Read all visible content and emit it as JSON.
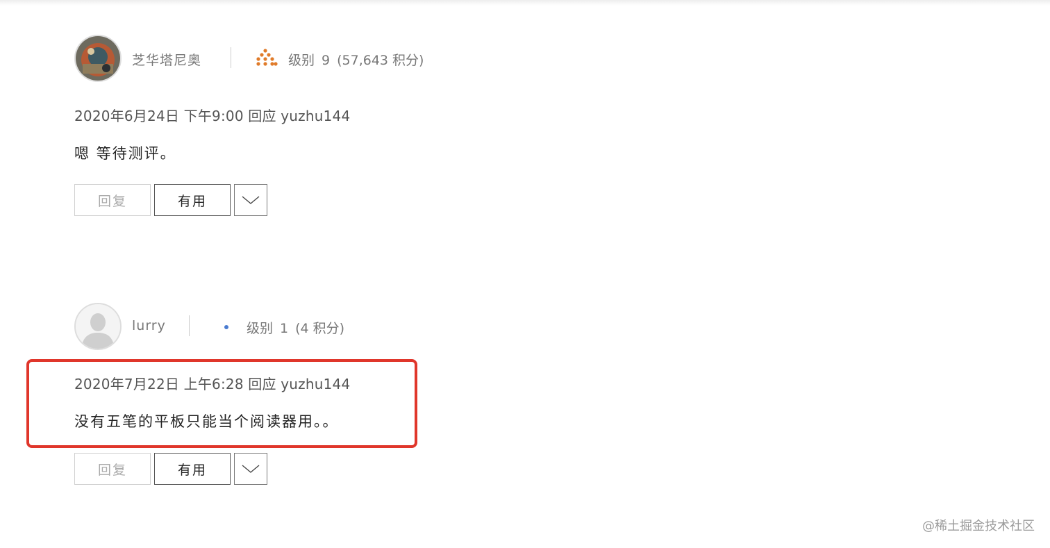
{
  "posts": [
    {
      "username": "芝华塔尼奥",
      "level_label": "级别",
      "level_value": "9",
      "points": "(57,643 积分)",
      "level_icon": "orange-dots-pyramid-icon",
      "level_icon_color": "#e07b2a",
      "meta": "2020年6月24日 下午9:00 回应 yuzhu144",
      "body": "嗯 等待测评。",
      "reply_label": "回复",
      "useful_label": "有用"
    },
    {
      "username": "lurry",
      "level_label": "级别",
      "level_value": "1",
      "points": "(4 积分)",
      "level_icon": "blue-dot-icon",
      "level_icon_color": "#4a7bd0",
      "meta": "2020年7月22日 上午6:28 回应 yuzhu144",
      "body": "没有五笔的平板只能当个阅读器用。。",
      "reply_label": "回复",
      "useful_label": "有用"
    }
  ],
  "highlight_color": "#e0362b",
  "watermark": "@稀土掘金技术社区"
}
